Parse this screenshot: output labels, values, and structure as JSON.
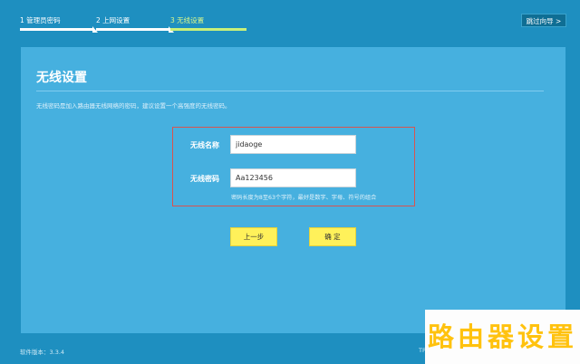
{
  "steps": [
    {
      "label": "1 管理员密码",
      "active": false
    },
    {
      "label": "2 上网设置",
      "active": false
    },
    {
      "label": "3 无线设置",
      "active": true
    }
  ],
  "skip_label": "跳过向导 >",
  "panel": {
    "title": "无线设置",
    "description": "无线密码是加入路由器无线网络的密码，建议设置一个高强度的无线密码。",
    "ssid": {
      "label": "无线名称",
      "value": "jidaoge"
    },
    "password": {
      "label": "无线密码",
      "value": "Aa123456"
    },
    "hint": "密码长度为8至63个字符，最好是数字、字母、符号的组合",
    "prev_label": "上一步",
    "confirm_label": "确 定"
  },
  "footer": {
    "version": "软件版本：3.3.4",
    "brand_fragment": "TP"
  },
  "watermark": "路由器设置",
  "colors": {
    "background": "#1e8fc0",
    "panel": "#46b0df",
    "active_step": "#c9f07a",
    "button": "#fff15a",
    "highlight_border": "#d9534f",
    "watermark_text": "#ffc20e"
  }
}
